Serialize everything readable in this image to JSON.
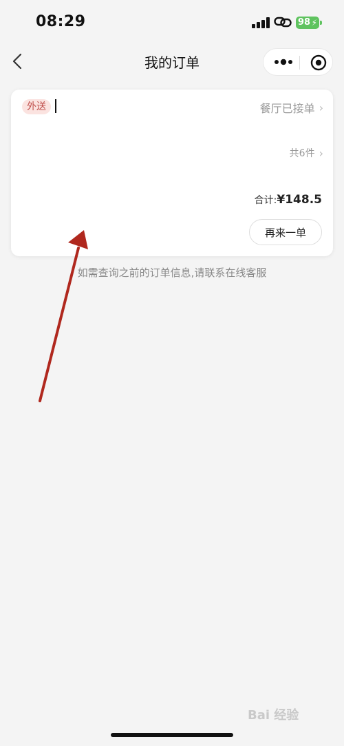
{
  "status_bar": {
    "time": "08:29",
    "battery_level": "98",
    "battery_color": "#5fc35f",
    "icons": [
      "signal-icon",
      "link-icon",
      "battery-icon"
    ]
  },
  "nav": {
    "title": "我的订单",
    "icons": [
      "back-icon",
      "more-icon",
      "close-miniprogram-icon"
    ]
  },
  "order": {
    "tag": "外送",
    "status": "餐厅已接单",
    "item_count": "共6件",
    "total_label": "合计:",
    "total_amount": "¥148.5",
    "reorder_label": "再来一单",
    "tag_color": "#c0504d"
  },
  "hint": "如需查询之前的订单信息,请联系在线客服",
  "watermark": "Bai 经验",
  "annotation_color": "#b0281e"
}
